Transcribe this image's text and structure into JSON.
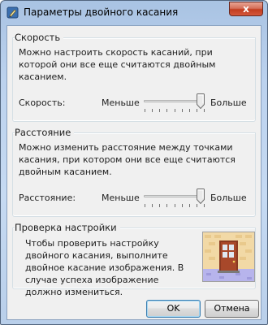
{
  "window": {
    "title": "Параметры двойного касания",
    "close_label": "x"
  },
  "speed_section": {
    "title": "Скорость",
    "description": "Можно настроить скорость касаний, при которой они все еще считаются двойным касанием.",
    "row_label": "Скорость:",
    "min_label": "Меньше",
    "max_label": "Больше",
    "value": 0.95
  },
  "distance_section": {
    "title": "Расстояние",
    "description": "Можно изменить расстояние между точками касания, при котором они все еще считаются двойным касанием.",
    "row_label": "Расстояние:",
    "min_label": "Меньше",
    "max_label": "Больше",
    "value": 0.95
  },
  "test_section": {
    "title": "Проверка настройки",
    "description": "Чтобы проверить настройку двойного касания, выполните двойное касание изображения. В случае успеха изображение должно измениться."
  },
  "buttons": {
    "ok_label": "OK",
    "cancel_label": "Отмена"
  }
}
